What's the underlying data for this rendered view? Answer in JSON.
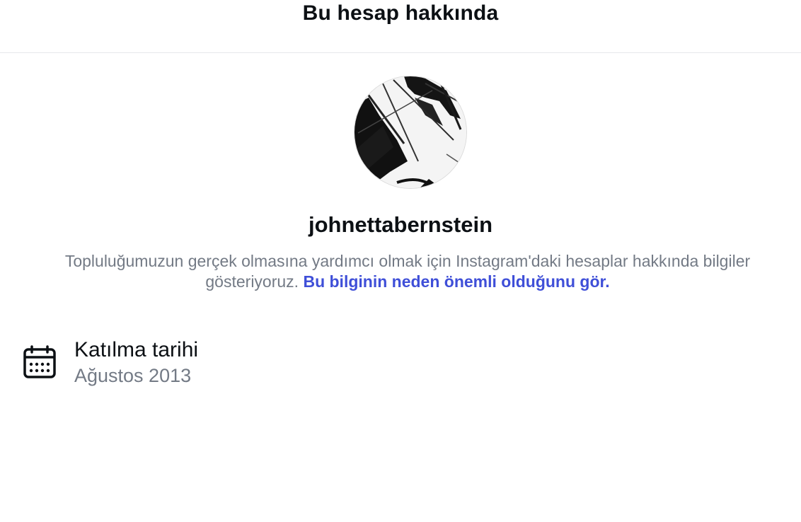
{
  "header": {
    "title": "Bu hesap hakkında"
  },
  "profile": {
    "username": "johnettabernstein",
    "description_text": "Topluluğumuzun gerçek olmasına yardımcı olmak için Instagram'daki hesaplar hakkında bilgiler gösteriyoruz.",
    "description_link": "Bu bilginin neden önemli olduğunu gör."
  },
  "info": {
    "joined_label": "Katılma tarihi",
    "joined_value": "Ağustos 2013",
    "icon": "calendar-icon"
  },
  "colors": {
    "text_primary": "#0c1014",
    "text_secondary": "#737a85",
    "link": "#3f4fd8",
    "divider": "#e6e8eb"
  }
}
